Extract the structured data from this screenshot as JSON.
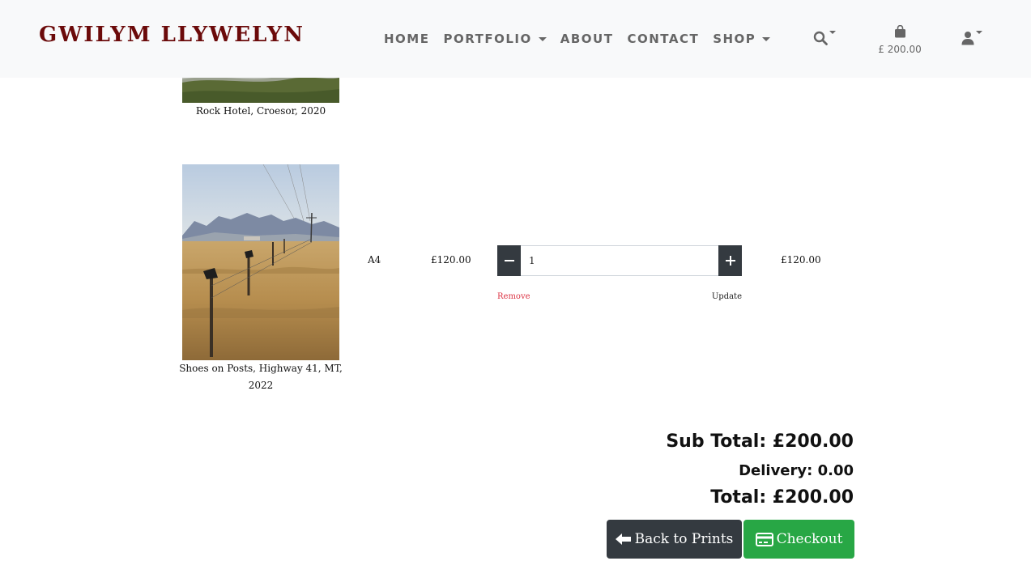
{
  "brand": "GWILYM LLYWELYN",
  "nav": {
    "items": [
      {
        "label": "HOME",
        "dropdown": false
      },
      {
        "label": "PORTFOLIO",
        "dropdown": true
      },
      {
        "label": "ABOUT",
        "dropdown": false
      },
      {
        "label": "CONTACT",
        "dropdown": false
      },
      {
        "label": "SHOP",
        "dropdown": true
      }
    ],
    "search_icon": "search-icon",
    "bag_icon": "shopping-bag-icon",
    "bag_total": "£ 200.00",
    "user_icon": "user-icon"
  },
  "cart": {
    "items": [
      {
        "title": "Rock Hotel, Croesor, 2020"
      },
      {
        "title": "Shoes on Posts, Highway 41, MT, 2022",
        "size": "A4",
        "price": "£120.00",
        "quantity": "1",
        "subtotal": "£120.00",
        "remove_label": "Remove",
        "update_label": "Update"
      }
    ]
  },
  "summary": {
    "sub_total": "Sub Total: £200.00",
    "delivery": "Delivery: 0.00",
    "total": "Total: £200.00"
  },
  "buttons": {
    "back_label": "Back to Prints",
    "back_icon": "arrow-left-icon",
    "checkout_label": "Checkout",
    "checkout_icon": "credit-card-icon"
  },
  "colors": {
    "brand": "#6b0a0a",
    "navbar_bg": "#f8f9fa",
    "dark_button": "#343a40",
    "checkout_button": "#28a745",
    "remove_link": "#dc3545"
  }
}
